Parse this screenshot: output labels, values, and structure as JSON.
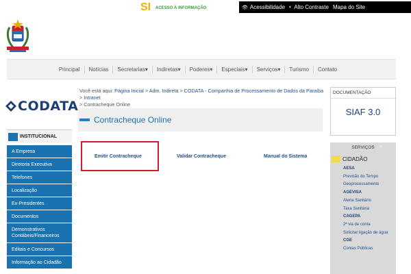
{
  "topbar": {
    "acesso_label": "ACESSO À INFORMAÇÃO",
    "acesso_logo": "SI",
    "items": [
      {
        "icon": "eye-icon",
        "glyph": "👁",
        "label": "Acessibilidade"
      },
      {
        "icon": "contrast-icon",
        "glyph": "◐",
        "label": "Alto Contraste"
      },
      {
        "icon": "",
        "glyph": "",
        "label": "Mapa do Site"
      }
    ]
  },
  "nav": {
    "items": [
      "Principal",
      "Notícias",
      "Secretarias▾",
      "Indiretas▾",
      "Poderes▾",
      "Especiais▾",
      "Serviços▾",
      "Turismo",
      "Contato"
    ]
  },
  "logo": {
    "text": "CODATA"
  },
  "breadcrumb": {
    "prefix": "Você está aqui:",
    "items": [
      "Página Inicial",
      "Adm. Indireta",
      "CODATA - Companhia de Processamento de Dados da Paraíba",
      "Intranet",
      "Contracheque Online"
    ]
  },
  "page_title": "Contracheque Online",
  "sidebar": {
    "header": "INSTITUCIONAL",
    "items": [
      "A Empresa",
      "Diretoria Executiva",
      "Telefones",
      "Localização",
      "Ex-Presidentes",
      "Documentos",
      "Demonstrativos Contábeis/Financeiros",
      "Editais e Concursos",
      "Informação ao Cidadão"
    ]
  },
  "links": [
    "Emitir Contracheque",
    "Validar Contracheque",
    "Manual do Sistema"
  ],
  "documentacao": {
    "title": "DOCUMENTAÇÃO",
    "value": "SIAF 3.0"
  },
  "servicos": {
    "title": "SERVIÇOS",
    "close": "×",
    "section": "CIDADÃO",
    "items": [
      {
        "label": "AESA",
        "bold": true
      },
      {
        "label": "Previsão do Tempo",
        "bold": false
      },
      {
        "label": "Geoprocessamento",
        "bold": false
      },
      {
        "label": "AGEVISA",
        "bold": true
      },
      {
        "label": "Alerta Sanitário",
        "bold": false
      },
      {
        "label": "Taxa Sanitária",
        "bold": false
      },
      {
        "label": "CAGEPA",
        "bold": true
      },
      {
        "label": "2ª via de conta",
        "bold": false
      },
      {
        "label": "Solicitar ligação de água",
        "bold": false
      },
      {
        "label": "CGE",
        "bold": true
      },
      {
        "label": "Contas Públicas",
        "bold": false
      }
    ]
  },
  "colors": {
    "brand_blue": "#1a72b0",
    "highlight_red": "#d6182c",
    "navy": "#1d3f75"
  }
}
